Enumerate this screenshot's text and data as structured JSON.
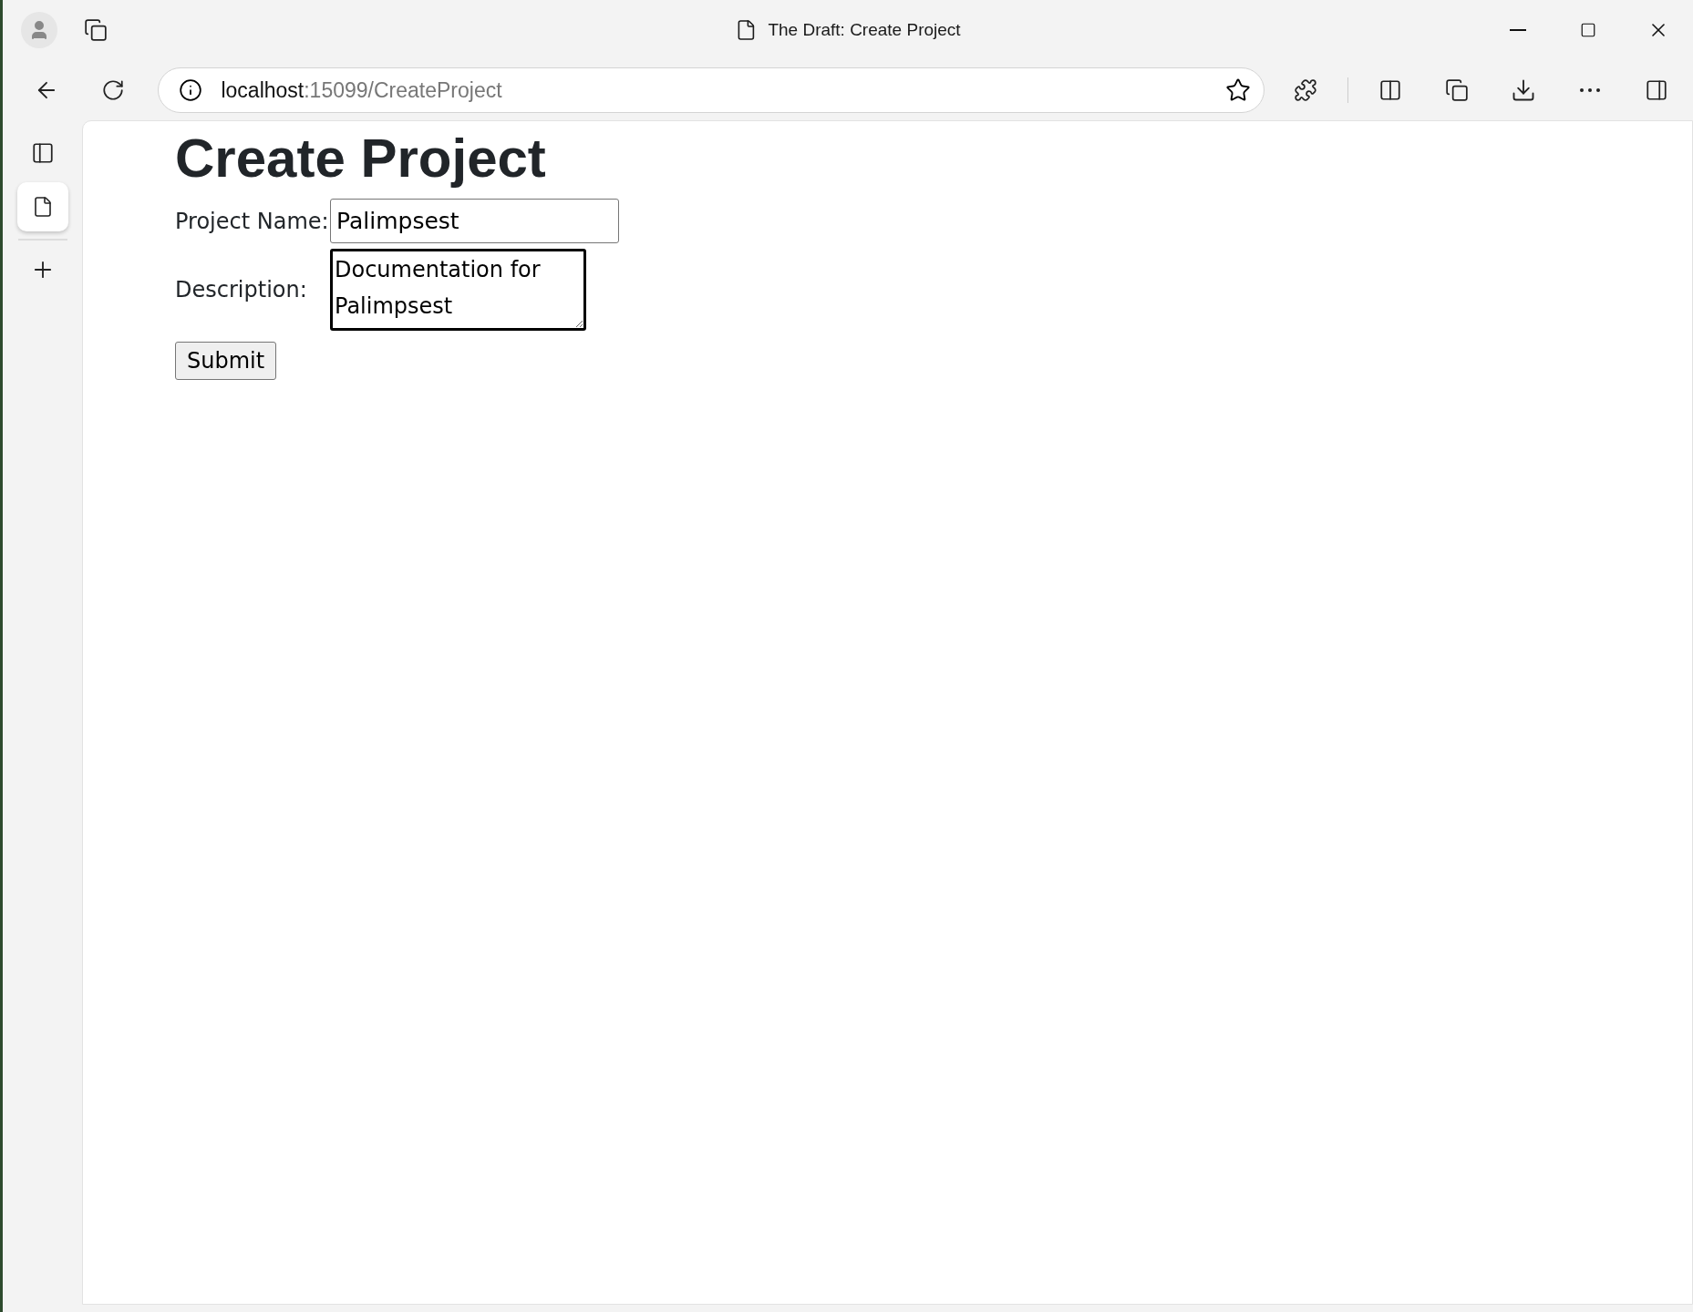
{
  "window": {
    "title": "The Draft: Create Project"
  },
  "address_bar": {
    "host": "localhost",
    "path": ":15099/CreateProject"
  },
  "sidebar": {
    "tabs": [
      {
        "selected": true
      }
    ]
  },
  "page": {
    "heading": "Create Project",
    "fields": [
      {
        "kind": "input",
        "label": "Project Name:",
        "value": "Palimpsest",
        "focused": false
      },
      {
        "kind": "textarea",
        "label": "Description:",
        "value": "Documentation for Palimpsest",
        "focused": true
      }
    ],
    "submit": "Submit"
  }
}
